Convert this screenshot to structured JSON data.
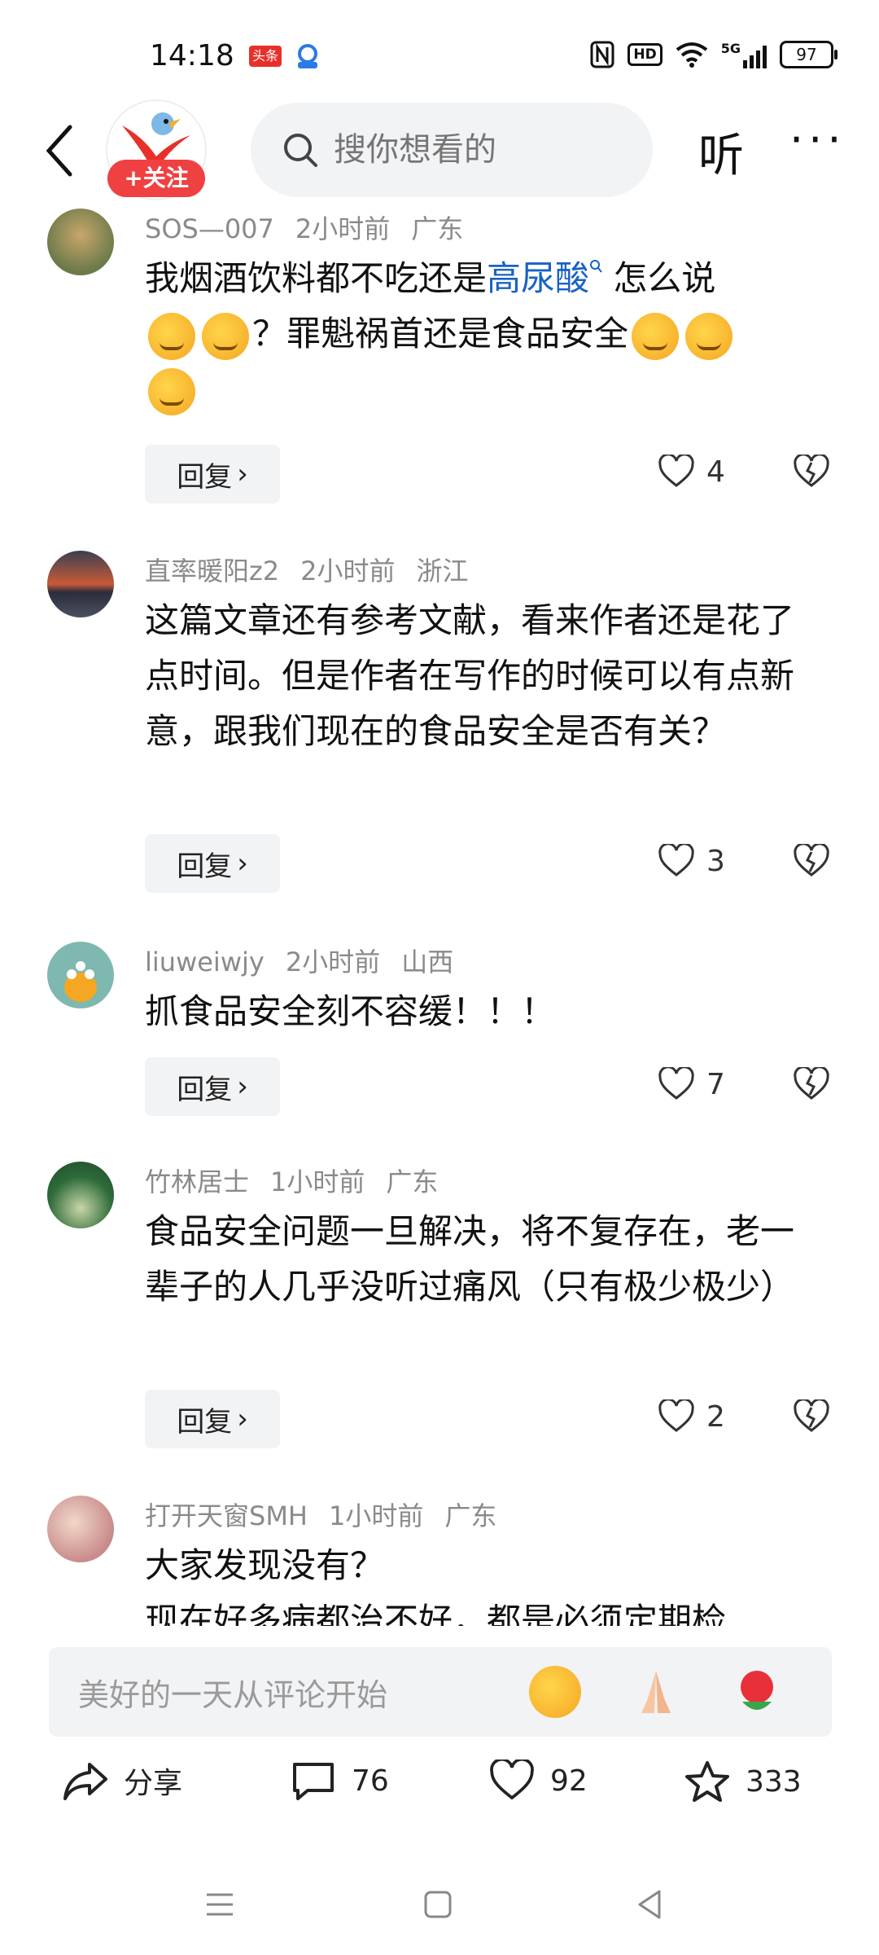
{
  "status_bar": {
    "time": "14:18",
    "app_badge": "头条",
    "hd_badge": "HD",
    "network": "5G",
    "battery": "97"
  },
  "header": {
    "follow_label": "+关注",
    "search_placeholder": "搜你想看的",
    "listen_label": "听",
    "more_label": "···"
  },
  "comments": [
    {
      "user": "SOS—007",
      "time": "2小时前",
      "location": "广东",
      "text_before": "我烟酒饮料都不吃还是",
      "highlight": "高尿酸",
      "text_after": " 怎么说",
      "text_line2": "？罪魁祸首还是食品安全",
      "reply_label": "回复",
      "likes": "4"
    },
    {
      "user": "直率暖阳z2",
      "time": "2小时前",
      "location": "浙江",
      "text": "这篇文章还有参考文献，看来作者还是花了点时间。但是作者在写作的时候可以有点新意，跟我们现在的食品安全是否有关？",
      "reply_label": "回复",
      "likes": "3"
    },
    {
      "user": "liuweiwjy",
      "time": "2小时前",
      "location": "山西",
      "text": "抓食品安全刻不容缓！！！",
      "reply_label": "回复",
      "likes": "7"
    },
    {
      "user": "竹林居士",
      "time": "1小时前",
      "location": "广东",
      "text": "食品安全问题一旦解决，将不复存在，老一辈子的人几乎没听过痛风（只有极少极少）",
      "reply_label": "回复",
      "likes": "2"
    },
    {
      "user": "打开天窗SMH",
      "time": "1小时前",
      "location": "广东",
      "text_line1": "大家发现没有？",
      "text_line2": "现在好多病都治不好，都是必须定期检"
    }
  ],
  "comment_bar": {
    "placeholder": "美好的一天从评论开始"
  },
  "actions": {
    "share_label": "分享",
    "comments_count": "76",
    "likes_count": "92",
    "favorites_count": "333"
  }
}
